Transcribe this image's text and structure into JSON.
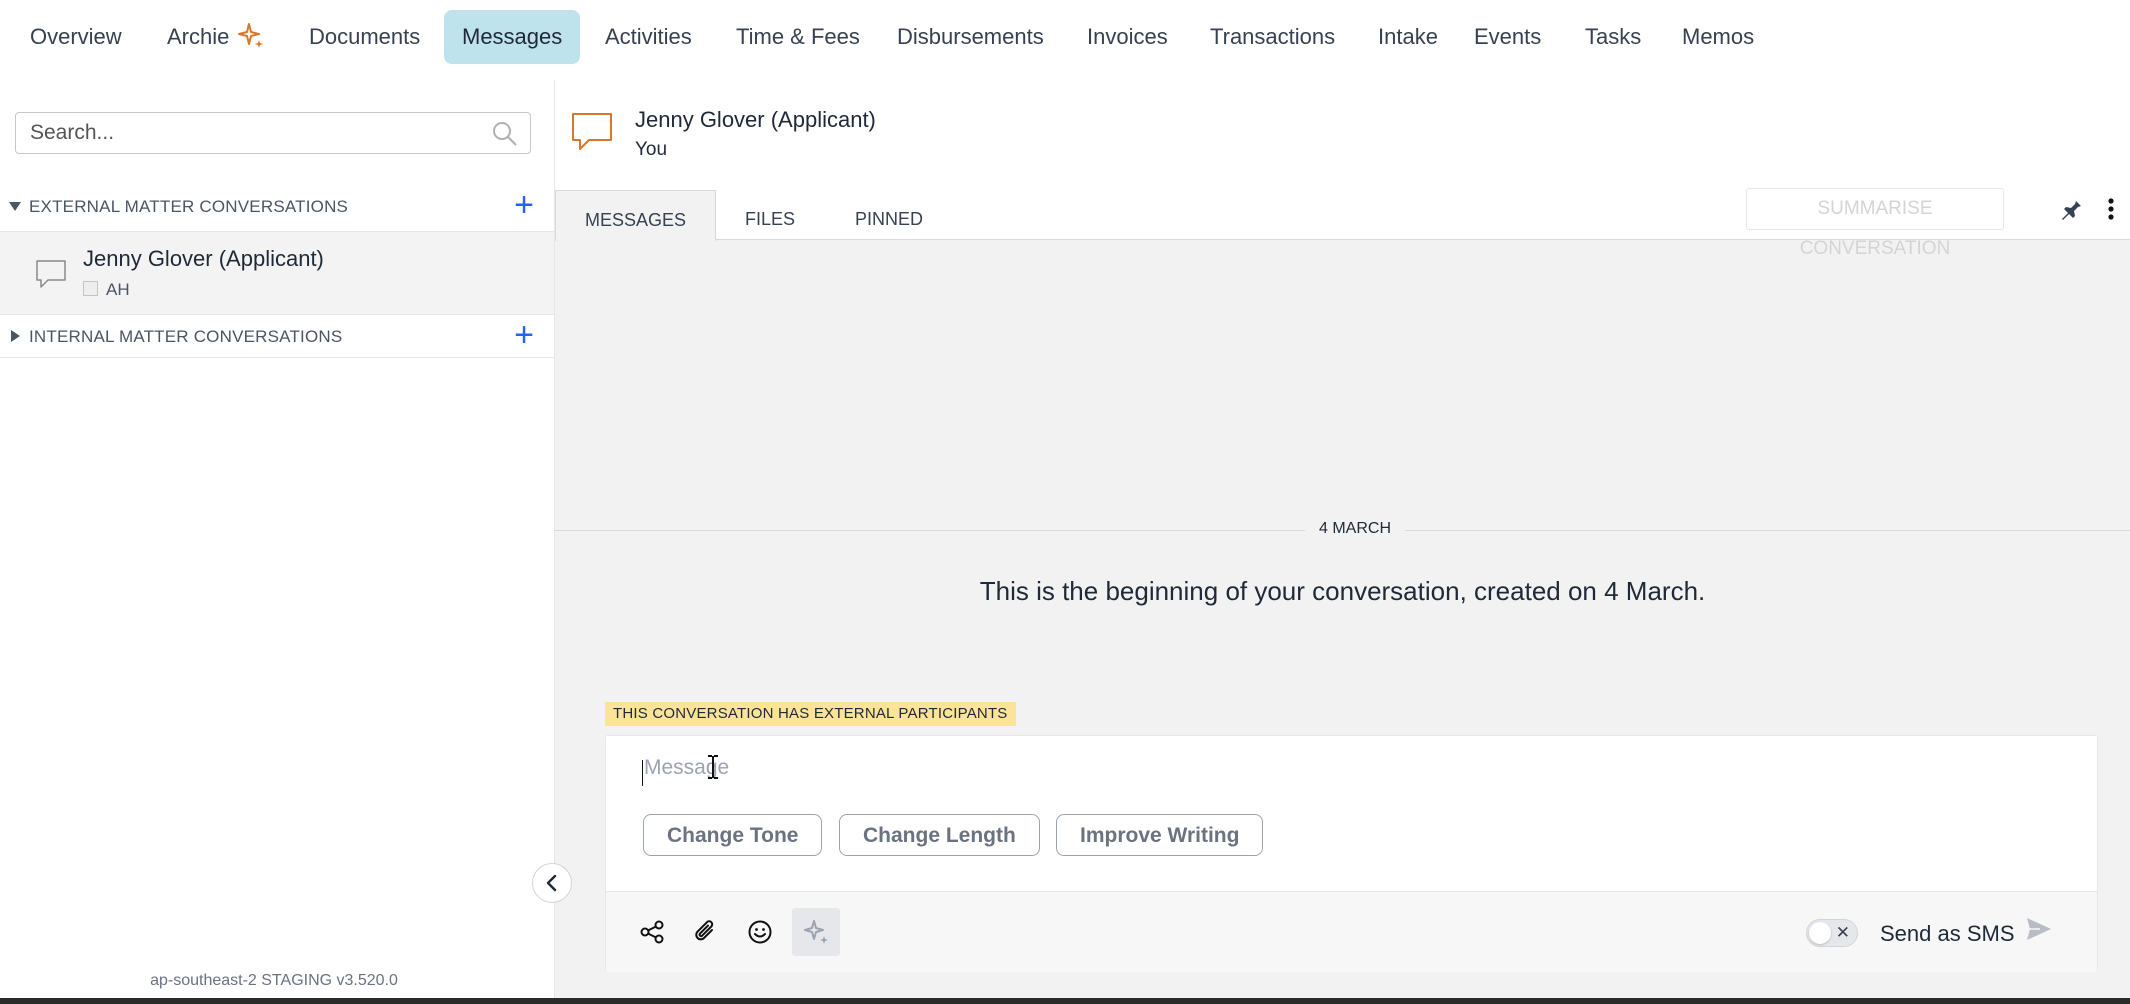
{
  "nav": {
    "items": [
      "Overview",
      "Archie",
      "Documents",
      "Messages",
      "Activities",
      "Time & Fees",
      "Disbursements",
      "Invoices",
      "Transactions",
      "Intake",
      "Events",
      "Tasks",
      "Memos"
    ],
    "active": "Messages",
    "archie_icon": "sparkle-icon"
  },
  "sidebar": {
    "search_placeholder": "Search...",
    "external_section": "EXTERNAL MATTER CONVERSATIONS",
    "internal_section": "INTERNAL MATTER CONVERSATIONS",
    "conversation": {
      "name": "Jenny Glover (Applicant)",
      "participant": "AH"
    },
    "version": "ap-southeast-2 STAGING v3.520.0"
  },
  "conversation": {
    "title": "Jenny Glover (Applicant)",
    "subtitle": "You",
    "tabs": [
      "MESSAGES",
      "FILES",
      "PINNED"
    ],
    "active_tab": "MESSAGES",
    "summarise_label": "SUMMARISE CONVERSATION",
    "date_label": "4 MARCH",
    "beginning_text": "This is the beginning of your conversation, created on 4 March.",
    "external_badge": "THIS CONVERSATION HAS EXTERNAL PARTICIPANTS"
  },
  "composer": {
    "placeholder": "Message",
    "ai_actions": [
      "Change Tone",
      "Change Length",
      "Improve Writing"
    ],
    "sms_label": "Send as SMS",
    "sms_enabled": false
  },
  "colors": {
    "active_tab_bg": "#bee3ec",
    "accent_blue": "#2563eb",
    "badge_yellow": "#fbe39a",
    "icon_orange": "#d9772b"
  }
}
